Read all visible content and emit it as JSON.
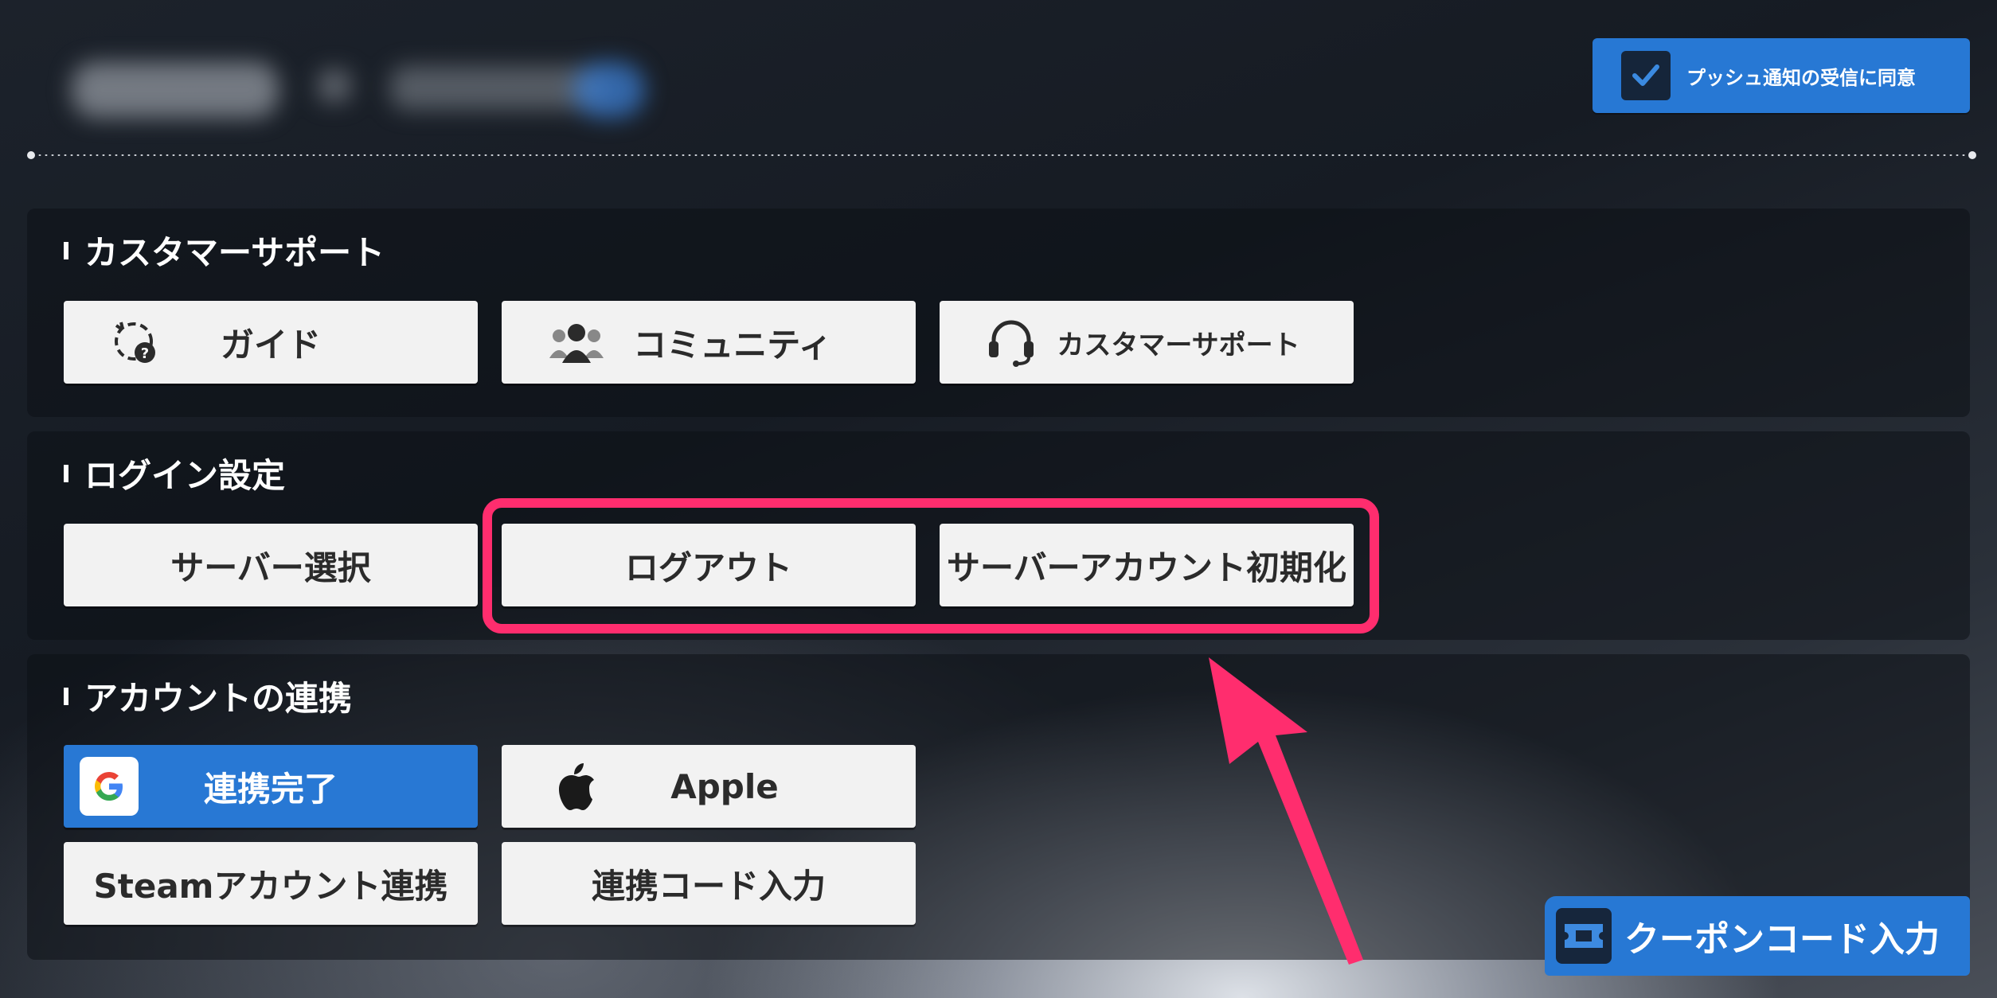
{
  "header": {
    "push_consent_label": "プッシュ通知の受信に同意",
    "push_consent_checked": true
  },
  "sections": {
    "support": {
      "title": "カスタマーサポート",
      "guide_label": "ガイド",
      "community_label": "コミュニティ",
      "support_label": "カスタマーサポート"
    },
    "login": {
      "title": "ログイン設定",
      "server_select_label": "サーバー選択",
      "logout_label": "ログアウト",
      "server_reset_label": "サーバーアカウント初期化"
    },
    "account_link": {
      "title": "アカウントの連携",
      "google_label": "連携完了",
      "apple_label": "Apple",
      "steam_label": "Steamアカウント連携",
      "link_code_label": "連携コード入力"
    }
  },
  "footer": {
    "coupon_label": "クーポンコード入力"
  },
  "colors": {
    "accent_blue": "#2778d4",
    "highlight_pink": "#ff2d6e",
    "button_bg": "#f2f2f2"
  }
}
